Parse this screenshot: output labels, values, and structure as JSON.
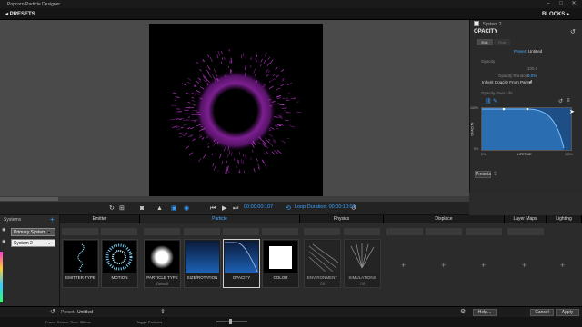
{
  "window": {
    "title": "Popcorn Particle Designer"
  },
  "topbar": {
    "presets_label": "PRESETS",
    "blocks_label": "BLOCKS"
  },
  "transport": {
    "timecode": "00:00:00:107",
    "loop_duration_label": "Loop Duration: 00:00:10:00"
  },
  "inspector": {
    "system_label": "System 2",
    "section_title": "OPACITY",
    "tabs": [
      "Edit",
      "Find"
    ],
    "preset_label": "Preset:",
    "preset_value": "Untitled",
    "opacity_label": "Opacity",
    "opacity_value": "100.0",
    "opacity_random_label": "Opacity Random",
    "opacity_random_value": "0.0%",
    "inherit_label": "Inherit Opacity From Parent",
    "over_life_label": "Opacity Over Life",
    "graph": {
      "y_label": "OPACITY",
      "x_label": "LIFETIME",
      "y_top": "100%",
      "y_bottom": "0%",
      "x_left": "0%",
      "x_right": "100%"
    },
    "presets_button": "Presets"
  },
  "systems": {
    "header": "Systems",
    "items": [
      "Primary System",
      "System 2"
    ]
  },
  "categories": [
    "Emitter",
    "Particle",
    "Physics",
    "Displace",
    "Layer Maps",
    "Lighting"
  ],
  "tiles": [
    {
      "label": "EMITTER TYPE",
      "sub": ""
    },
    {
      "label": "MOTION",
      "sub": ""
    },
    {
      "label": "PARTICLE TYPE",
      "sub": "Default"
    },
    {
      "label": "SIZE/ROTATION",
      "sub": ""
    },
    {
      "label": "OPACITY",
      "sub": ""
    },
    {
      "label": "COLOR",
      "sub": ""
    },
    {
      "label": "ENVIRONMENT",
      "sub": "Off"
    },
    {
      "label": "SIMULATIONS",
      "sub": "Off"
    }
  ],
  "bottombar": {
    "preset_label": "Preset:",
    "preset_value": "Untitled",
    "help_label": "Help...",
    "cancel_label": "Cancel",
    "apply_label": "Apply"
  },
  "statusbar": {
    "render_time": "Frame Render Time: 356ms",
    "toggle_label": "Toggle Particles"
  },
  "colors": {
    "accent": "#3aa0ff",
    "particle": "#d23ce6",
    "graph_fill": "#1d4f86"
  }
}
